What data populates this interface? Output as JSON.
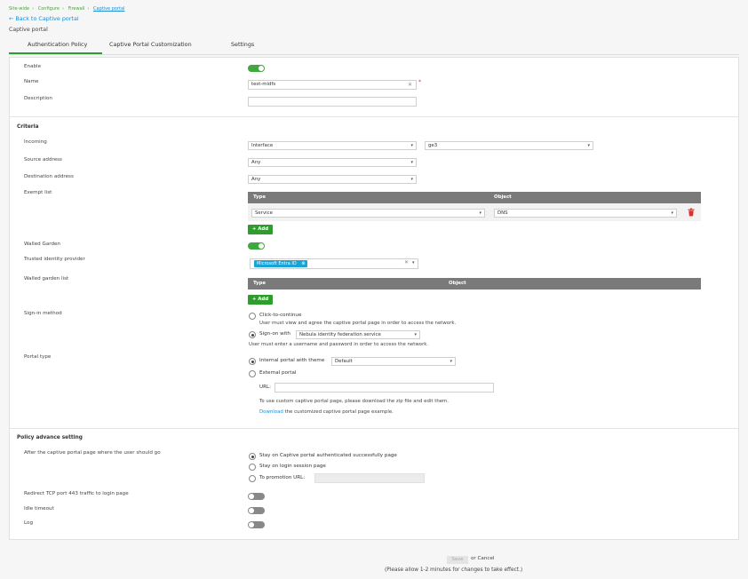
{
  "breadcrumb": [
    "Site-wide",
    "Configure",
    "Firewall",
    "Captive portal"
  ],
  "back_label": "← Back to Captive portal",
  "page_title": "Captive portal",
  "tabs": [
    "Authentication Policy",
    "Captive Portal Customization",
    "Settings"
  ],
  "general": {
    "enable_label": "Enable",
    "enable_on": true,
    "name_label": "Name",
    "name_value": "test-midfs",
    "required_mark": "*",
    "description_label": "Description",
    "description_value": ""
  },
  "criteria": {
    "section_title": "Criteria",
    "incoming_label": "Incoming",
    "incoming_type": "Interface",
    "incoming_value": "ge3",
    "source_label": "Source address",
    "source_value": "Any",
    "destination_label": "Destination address",
    "destination_value": "Any",
    "exempt_label": "Exempt list",
    "exempt_headers": [
      "Type",
      "Object"
    ],
    "exempt_rows": [
      {
        "type": "Service",
        "object": "DNS"
      }
    ],
    "add_label": "+ Add",
    "walled_label": "Walled Garden",
    "walled_on": true,
    "idp_label": "Trusted identity provider",
    "idp_chip": "Microsoft Entra ID",
    "walled_list_label": "Walled garden list",
    "walled_headers": [
      "Type",
      "Object"
    ],
    "signin_label": "Sign-in method",
    "signin_click": "Click-to-continue",
    "signin_click_note": "User must view and agree the captive portal page in order to access the network.",
    "signin_sso": "Sign-on with",
    "signin_sso_value": "Nebula identity federation service",
    "signin_sso_note": "User must enter a username and password in order to access the network.",
    "portal_label": "Portal type",
    "portal_internal": "Internal portal with theme",
    "portal_theme": "Default",
    "portal_external": "External portal",
    "url_label": "URL:",
    "url_value": "",
    "custom_note": "To use custom captive portal page, please download the zip file and edit them.",
    "download_link": "Download",
    "download_rest": "the customized captive portal page example."
  },
  "advanced": {
    "section_title": "Policy advance setting",
    "after_label": "After the captive portal page where the user should go",
    "opt_success": "Stay on Captive portal authenticated successfully page",
    "opt_login": "Stay on login session page",
    "opt_promo": "To promotion URL:",
    "promo_value": "",
    "redirect_label": "Redirect TCP port 443 traffic to login page",
    "redirect_on": false,
    "idle_label": "Idle timeout",
    "idle_on": false,
    "log_label": "Log",
    "log_on": false
  },
  "footer": {
    "save_label": "Save",
    "or_cancel": "or Cancel",
    "note": "(Please allow 1-2 minutes for changes to take effect.)"
  },
  "colors": {
    "accent_green": "#2e9d2e",
    "link_blue": "#1a8bd6",
    "chip_blue": "#19a3d6",
    "delete_red": "#d9322e"
  }
}
